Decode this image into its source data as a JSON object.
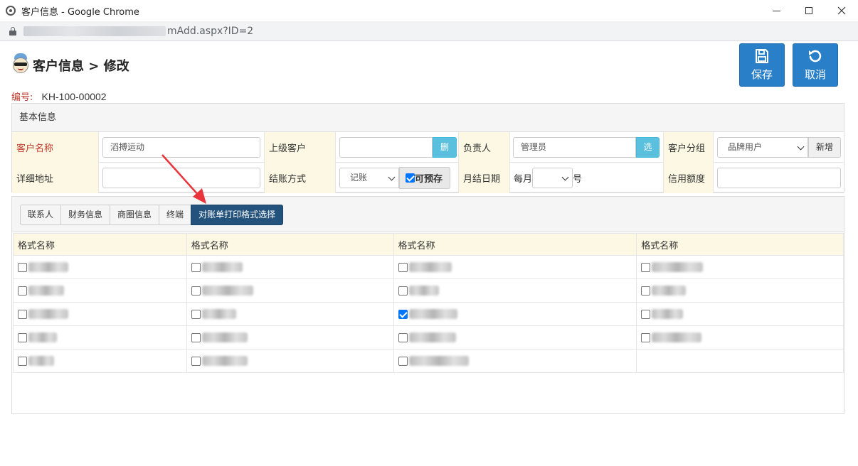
{
  "window": {
    "title": "客户信息 - Google Chrome",
    "url_suffix": "mAdd.aspx?ID=2"
  },
  "header": {
    "title": "客户信息 > 修改",
    "save_label": "保存",
    "cancel_label": "取消"
  },
  "code": {
    "label": "编号:",
    "value": "KH-100-00002"
  },
  "basic": {
    "heading": "基本信息",
    "customer_name_label": "客户名称",
    "customer_name_value": "滔搏运动",
    "parent_customer_label": "上级客户",
    "parent_customer_value": "",
    "delete_btn": "删",
    "owner_label": "负责人",
    "owner_value": "管理员",
    "select_btn": "选",
    "group_label": "客户分组",
    "group_value": "品牌用户",
    "add_btn": "新增",
    "address_label": "详细地址",
    "address_value": "",
    "settle_label": "结账方式",
    "settle_value": "记账",
    "prestore_label": "可预存",
    "prestore_checked": true,
    "monthly_date_label": "月结日期",
    "monthly_prefix": "每月",
    "monthly_value": "",
    "monthly_suffix": "号",
    "credit_label": "信用额度",
    "credit_value": ""
  },
  "tabs": [
    {
      "label": "联系人",
      "active": false
    },
    {
      "label": "财务信息",
      "active": false
    },
    {
      "label": "商圈信息",
      "active": false
    },
    {
      "label": "终端",
      "active": false
    },
    {
      "label": "对账单打印格式选择",
      "active": true
    }
  ],
  "format_table": {
    "headers": [
      "格式名称",
      "格式名称",
      "格式名称",
      "格式名称"
    ],
    "rows": [
      [
        {
          "checked": false
        },
        {
          "checked": false
        },
        {
          "checked": false
        },
        {
          "checked": false
        }
      ],
      [
        {
          "checked": false
        },
        {
          "checked": false
        },
        {
          "checked": false
        },
        {
          "checked": false
        }
      ],
      [
        {
          "checked": false
        },
        {
          "checked": false
        },
        {
          "checked": true
        },
        {
          "checked": false
        }
      ],
      [
        {
          "checked": false
        },
        {
          "checked": false
        },
        {
          "checked": false
        },
        {
          "checked": false
        }
      ],
      [
        {
          "checked": false
        },
        {
          "checked": false
        },
        {
          "checked": false
        },
        null
      ]
    ]
  },
  "colors": {
    "primary_button": "#2a7fc9",
    "active_tab": "#23527c",
    "label_bg": "#fcf8e3",
    "required_label": "#c0392b",
    "annotation_arrow": "#e8343a"
  }
}
